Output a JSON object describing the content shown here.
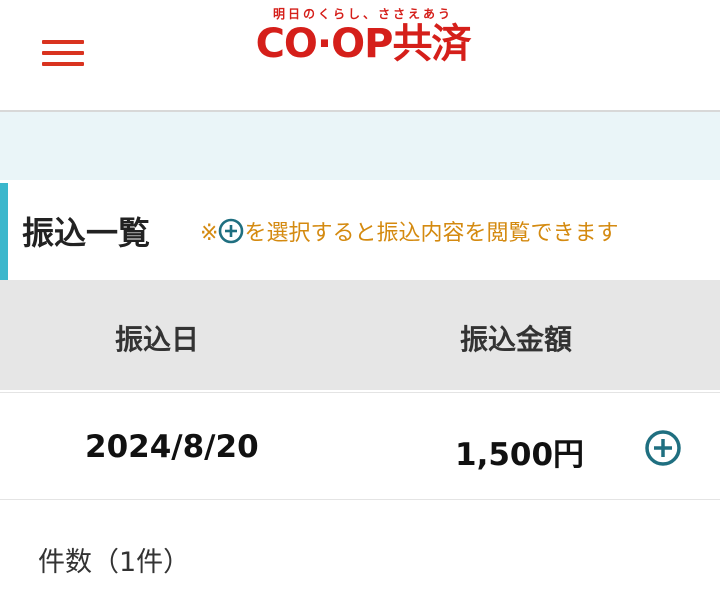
{
  "header": {
    "logo_tagline": "明日のくらし、ささえあう",
    "logo_text": "CO·OP共済",
    "brand_color": "#d51f1a",
    "menu_icon": "hamburger-menu-icon"
  },
  "section": {
    "title": "振込一覧",
    "note_prefix": "※",
    "note_icon": "plus-circle-icon",
    "note_text": "を選択すると振込内容を閲覧できます",
    "accent_color": "#3cb7cc",
    "note_color": "#d48a10"
  },
  "table": {
    "headers": [
      "振込日",
      "振込金額"
    ],
    "rows": [
      {
        "date": "2024/8/20",
        "amount": "1,500円"
      }
    ]
  },
  "footer": {
    "count_text": "件数（1件）"
  }
}
